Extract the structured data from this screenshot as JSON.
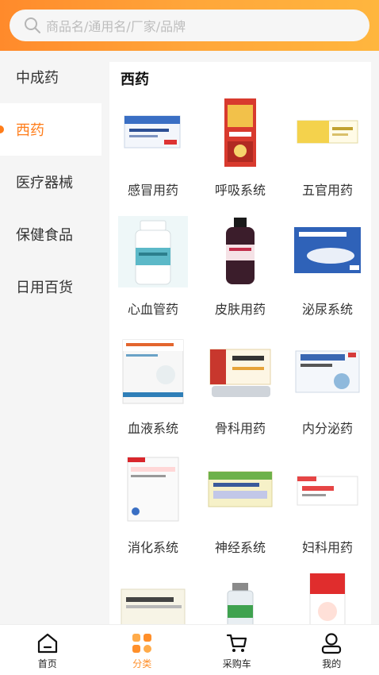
{
  "search": {
    "placeholder": "商品名/通用名/厂家/品牌"
  },
  "sidebar": {
    "items": [
      {
        "label": "中成药"
      },
      {
        "label": "西药"
      },
      {
        "label": "医疗器械"
      },
      {
        "label": "保健食品"
      },
      {
        "label": "日用百货"
      }
    ],
    "active_index": 1
  },
  "main": {
    "title": "西药",
    "categories": [
      {
        "label": "感冒用药"
      },
      {
        "label": "呼吸系统"
      },
      {
        "label": "五官用药"
      },
      {
        "label": "心血管药"
      },
      {
        "label": "皮肤用药"
      },
      {
        "label": "泌尿系统"
      },
      {
        "label": "血液系统"
      },
      {
        "label": "骨科用药"
      },
      {
        "label": "内分泌药"
      },
      {
        "label": "消化系统"
      },
      {
        "label": "神经系统"
      },
      {
        "label": "妇科用药"
      },
      {
        "label": ""
      },
      {
        "label": ""
      },
      {
        "label": ""
      }
    ]
  },
  "tabbar": {
    "items": [
      {
        "label": "首页",
        "icon": "home-icon"
      },
      {
        "label": "分类",
        "icon": "category-icon"
      },
      {
        "label": "采购车",
        "icon": "cart-icon"
      },
      {
        "label": "我的",
        "icon": "profile-icon"
      }
    ],
    "active_index": 1
  },
  "colors": {
    "accent": "#ff7d1a",
    "header_start": "#ff8a2b",
    "header_end": "#ffb63e"
  }
}
